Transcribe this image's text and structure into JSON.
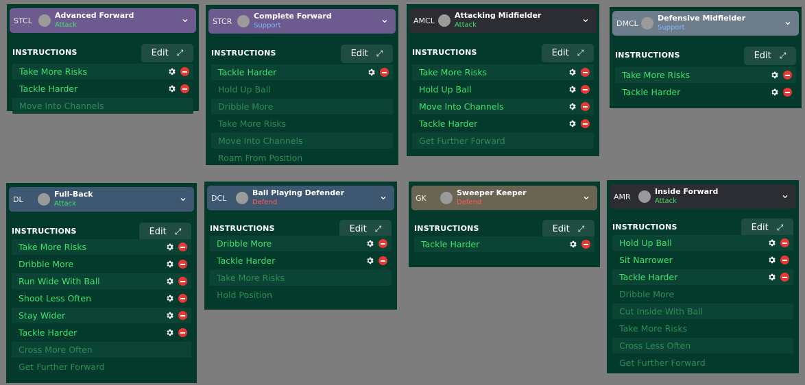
{
  "colors": {
    "attack": "#3fe06a",
    "support": "#7eb8ff",
    "defend": "#ff5b5b",
    "panel_bg": "#043a2c",
    "active_instruction": "#3fe06a",
    "inactive_instruction": "#2e8b56"
  },
  "instructions_label": "INSTRUCTIONS",
  "edit_label": "Edit",
  "icons": {
    "expand": "expand-icon",
    "settings": "gear-icon",
    "remove": "remove-icon",
    "dropdown": "chevron-down-icon"
  },
  "panels": [
    {
      "position": "STCL",
      "role": "Advanced Forward",
      "duty": "Attack",
      "duty_key": "attack",
      "role_color": "#6d5a8e",
      "instructions": [
        {
          "label": "Take More Risks",
          "active": true
        },
        {
          "label": "Tackle Harder",
          "active": true
        },
        {
          "label": "Move Into Channels",
          "active": false
        }
      ]
    },
    {
      "position": "STCR",
      "role": "Complete Forward",
      "duty": "Support",
      "duty_key": "support",
      "role_color": "#6d5a8e",
      "instructions": [
        {
          "label": "Tackle Harder",
          "active": true
        },
        {
          "label": "Hold Up Ball",
          "active": false
        },
        {
          "label": "Dribble More",
          "active": false
        },
        {
          "label": "Take More Risks",
          "active": false
        },
        {
          "label": "Move Into Channels",
          "active": false
        },
        {
          "label": "Roam From Position",
          "active": false
        }
      ]
    },
    {
      "position": "AMCL",
      "role": "Attacking Midfielder",
      "duty": "Attack",
      "duty_key": "attack",
      "role_color": "#2b2d33",
      "instructions": [
        {
          "label": "Take More Risks",
          "active": true
        },
        {
          "label": "Hold Up Ball",
          "active": true
        },
        {
          "label": "Move Into Channels",
          "active": true
        },
        {
          "label": "Tackle Harder",
          "active": true
        },
        {
          "label": "Get Further Forward",
          "active": false
        }
      ]
    },
    {
      "position": "DMCL",
      "role": "Defensive Midfielder",
      "duty": "Support",
      "duty_key": "support",
      "role_color": "#6e7d8c",
      "instructions": [
        {
          "label": "Take More Risks",
          "active": true
        },
        {
          "label": "Tackle Harder",
          "active": true
        }
      ]
    },
    {
      "position": "DL",
      "role": "Full-Back",
      "duty": "Attack",
      "duty_key": "attack",
      "role_color": "#3e5872",
      "instructions": [
        {
          "label": "Take More Risks",
          "active": true
        },
        {
          "label": "Dribble More",
          "active": true
        },
        {
          "label": "Run Wide With Ball",
          "active": true
        },
        {
          "label": "Shoot Less Often",
          "active": true
        },
        {
          "label": "Stay Wider",
          "active": true
        },
        {
          "label": "Tackle Harder",
          "active": true
        },
        {
          "label": "Cross More Often",
          "active": false
        },
        {
          "label": "Get Further Forward",
          "active": false
        }
      ]
    },
    {
      "position": "DCL",
      "role": "Ball Playing Defender",
      "duty": "Defend",
      "duty_key": "defend",
      "role_color": "#3e5872",
      "instructions": [
        {
          "label": "Dribble More",
          "active": true
        },
        {
          "label": "Tackle Harder",
          "active": true
        },
        {
          "label": "Take More Risks",
          "active": false
        },
        {
          "label": "Hold Position",
          "active": false
        }
      ]
    },
    {
      "position": "GK",
      "role": "Sweeper Keeper",
      "duty": "Defend",
      "duty_key": "defend",
      "role_color": "#6a6453",
      "instructions": [
        {
          "label": "Tackle Harder",
          "active": true
        }
      ]
    },
    {
      "position": "AMR",
      "role": "Inside Forward",
      "duty": "Attack",
      "duty_key": "attack",
      "role_color": "#2b2d33",
      "instructions": [
        {
          "label": "Hold Up Ball",
          "active": true
        },
        {
          "label": "Sit Narrower",
          "active": true
        },
        {
          "label": "Tackle Harder",
          "active": true
        },
        {
          "label": "Dribble More",
          "active": false
        },
        {
          "label": "Cut Inside With Ball",
          "active": false
        },
        {
          "label": "Take More Risks",
          "active": false
        },
        {
          "label": "Cross Less Often",
          "active": false
        },
        {
          "label": "Get Further Forward",
          "active": false
        }
      ]
    }
  ]
}
